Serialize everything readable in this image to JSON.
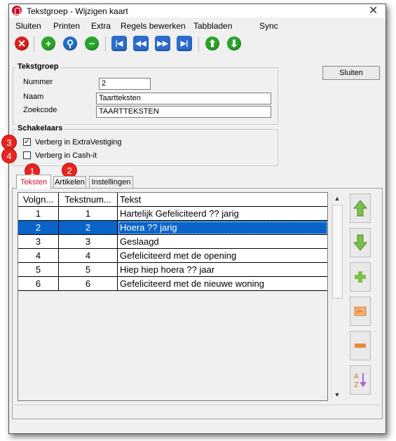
{
  "window": {
    "title": "Tekstgroep - Wijzigen kaart",
    "close_glyph": "✕"
  },
  "menu": [
    {
      "label": "Sluiten"
    },
    {
      "label": "Printen"
    },
    {
      "label": "Extra"
    },
    {
      "label": "Regels bewerken"
    },
    {
      "label": "Tabbladen"
    },
    {
      "label": "Sync"
    }
  ],
  "toolbar": {
    "close_glyph": "✕",
    "add_glyph": "+",
    "search_glyph": "⚲",
    "remove_glyph": "−",
    "first_glyph": "|◀",
    "prev_glyph": "◀◀",
    "next_glyph": "▶▶",
    "last_glyph": "▶|",
    "up_glyph": "⬆",
    "down_glyph": "⬇"
  },
  "tekstgroep": {
    "legend": "Tekstgroep",
    "nummer_label": "Nummer",
    "nummer_value": "2",
    "naam_label": "Naam",
    "naam_value": "Taartteksten",
    "zoekcode_label": "Zoekcode",
    "zoekcode_value": "TAARTTEKSTEN"
  },
  "sluiten_button": "Sluiten",
  "schakelaars": {
    "legend": "Schakelaars",
    "options": [
      {
        "label": "Verberg in ExtraVestiging",
        "checked": true,
        "mark": "✓"
      },
      {
        "label": "Verberg in Cash-it",
        "checked": false,
        "mark": ""
      }
    ]
  },
  "badges": [
    "1",
    "2",
    "3",
    "4"
  ],
  "tabs": [
    {
      "label": "Teksten",
      "active": true
    },
    {
      "label": "Artikelen",
      "active": false
    },
    {
      "label": "Instellingen",
      "active": false
    }
  ],
  "grid": {
    "headers": [
      "Volgn...",
      "Tekstnum...",
      "Tekst"
    ],
    "rows": [
      {
        "volgnummer": "1",
        "tekstnummer": "1",
        "tekst": "Hartelijk Gefeliciteerd ?? jarig",
        "selected": false
      },
      {
        "volgnummer": "2",
        "tekstnummer": "2",
        "tekst": "Hoera ?? jarig",
        "selected": true
      },
      {
        "volgnummer": "3",
        "tekstnummer": "3",
        "tekst": "Geslaagd",
        "selected": false
      },
      {
        "volgnummer": "4",
        "tekstnummer": "4",
        "tekst": "Gefeliciteerd met de opening",
        "selected": false
      },
      {
        "volgnummer": "5",
        "tekstnummer": "5",
        "tekst": "Hiep hiep hoera ?? jaar",
        "selected": false
      },
      {
        "volgnummer": "6",
        "tekstnummer": "6",
        "tekst": "Gefeliciteerd met de nieuwe woning",
        "selected": false
      }
    ]
  },
  "scroll": {
    "up_glyph": "▲",
    "down_glyph": "▼"
  },
  "colors": {
    "accent": "#c8102e",
    "selection": "#0a64c8",
    "badge": "#e8241e",
    "side_green": "#7cc04a",
    "side_orange": "#e88a3a"
  }
}
